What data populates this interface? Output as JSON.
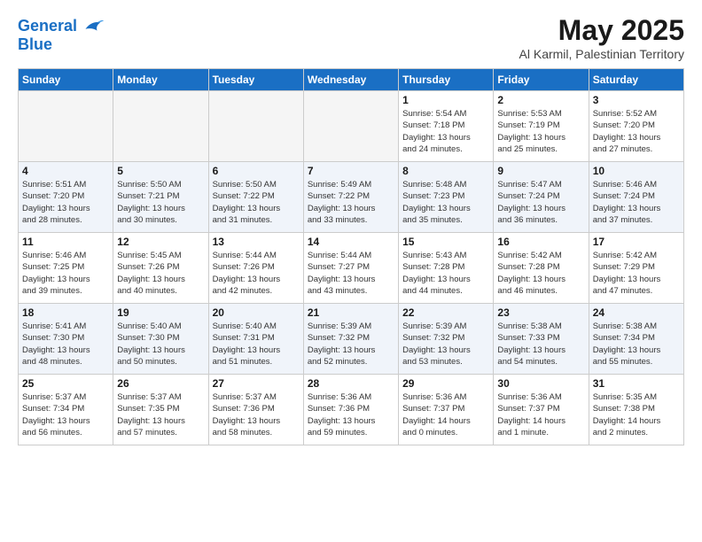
{
  "header": {
    "logo_line1": "General",
    "logo_line2": "Blue",
    "month_title": "May 2025",
    "location": "Al Karmil, Palestinian Territory"
  },
  "days_of_week": [
    "Sunday",
    "Monday",
    "Tuesday",
    "Wednesday",
    "Thursday",
    "Friday",
    "Saturday"
  ],
  "weeks": [
    [
      {
        "day": "",
        "empty": true
      },
      {
        "day": "",
        "empty": true
      },
      {
        "day": "",
        "empty": true
      },
      {
        "day": "",
        "empty": true
      },
      {
        "day": "1",
        "lines": [
          "Sunrise: 5:54 AM",
          "Sunset: 7:18 PM",
          "Daylight: 13 hours",
          "and 24 minutes."
        ]
      },
      {
        "day": "2",
        "lines": [
          "Sunrise: 5:53 AM",
          "Sunset: 7:19 PM",
          "Daylight: 13 hours",
          "and 25 minutes."
        ]
      },
      {
        "day": "3",
        "lines": [
          "Sunrise: 5:52 AM",
          "Sunset: 7:20 PM",
          "Daylight: 13 hours",
          "and 27 minutes."
        ]
      }
    ],
    [
      {
        "day": "4",
        "lines": [
          "Sunrise: 5:51 AM",
          "Sunset: 7:20 PM",
          "Daylight: 13 hours",
          "and 28 minutes."
        ]
      },
      {
        "day": "5",
        "lines": [
          "Sunrise: 5:50 AM",
          "Sunset: 7:21 PM",
          "Daylight: 13 hours",
          "and 30 minutes."
        ]
      },
      {
        "day": "6",
        "lines": [
          "Sunrise: 5:50 AM",
          "Sunset: 7:22 PM",
          "Daylight: 13 hours",
          "and 31 minutes."
        ]
      },
      {
        "day": "7",
        "lines": [
          "Sunrise: 5:49 AM",
          "Sunset: 7:22 PM",
          "Daylight: 13 hours",
          "and 33 minutes."
        ]
      },
      {
        "day": "8",
        "lines": [
          "Sunrise: 5:48 AM",
          "Sunset: 7:23 PM",
          "Daylight: 13 hours",
          "and 35 minutes."
        ]
      },
      {
        "day": "9",
        "lines": [
          "Sunrise: 5:47 AM",
          "Sunset: 7:24 PM",
          "Daylight: 13 hours",
          "and 36 minutes."
        ]
      },
      {
        "day": "10",
        "lines": [
          "Sunrise: 5:46 AM",
          "Sunset: 7:24 PM",
          "Daylight: 13 hours",
          "and 37 minutes."
        ]
      }
    ],
    [
      {
        "day": "11",
        "lines": [
          "Sunrise: 5:46 AM",
          "Sunset: 7:25 PM",
          "Daylight: 13 hours",
          "and 39 minutes."
        ]
      },
      {
        "day": "12",
        "lines": [
          "Sunrise: 5:45 AM",
          "Sunset: 7:26 PM",
          "Daylight: 13 hours",
          "and 40 minutes."
        ]
      },
      {
        "day": "13",
        "lines": [
          "Sunrise: 5:44 AM",
          "Sunset: 7:26 PM",
          "Daylight: 13 hours",
          "and 42 minutes."
        ]
      },
      {
        "day": "14",
        "lines": [
          "Sunrise: 5:44 AM",
          "Sunset: 7:27 PM",
          "Daylight: 13 hours",
          "and 43 minutes."
        ]
      },
      {
        "day": "15",
        "lines": [
          "Sunrise: 5:43 AM",
          "Sunset: 7:28 PM",
          "Daylight: 13 hours",
          "and 44 minutes."
        ]
      },
      {
        "day": "16",
        "lines": [
          "Sunrise: 5:42 AM",
          "Sunset: 7:28 PM",
          "Daylight: 13 hours",
          "and 46 minutes."
        ]
      },
      {
        "day": "17",
        "lines": [
          "Sunrise: 5:42 AM",
          "Sunset: 7:29 PM",
          "Daylight: 13 hours",
          "and 47 minutes."
        ]
      }
    ],
    [
      {
        "day": "18",
        "lines": [
          "Sunrise: 5:41 AM",
          "Sunset: 7:30 PM",
          "Daylight: 13 hours",
          "and 48 minutes."
        ]
      },
      {
        "day": "19",
        "lines": [
          "Sunrise: 5:40 AM",
          "Sunset: 7:30 PM",
          "Daylight: 13 hours",
          "and 50 minutes."
        ]
      },
      {
        "day": "20",
        "lines": [
          "Sunrise: 5:40 AM",
          "Sunset: 7:31 PM",
          "Daylight: 13 hours",
          "and 51 minutes."
        ]
      },
      {
        "day": "21",
        "lines": [
          "Sunrise: 5:39 AM",
          "Sunset: 7:32 PM",
          "Daylight: 13 hours",
          "and 52 minutes."
        ]
      },
      {
        "day": "22",
        "lines": [
          "Sunrise: 5:39 AM",
          "Sunset: 7:32 PM",
          "Daylight: 13 hours",
          "and 53 minutes."
        ]
      },
      {
        "day": "23",
        "lines": [
          "Sunrise: 5:38 AM",
          "Sunset: 7:33 PM",
          "Daylight: 13 hours",
          "and 54 minutes."
        ]
      },
      {
        "day": "24",
        "lines": [
          "Sunrise: 5:38 AM",
          "Sunset: 7:34 PM",
          "Daylight: 13 hours",
          "and 55 minutes."
        ]
      }
    ],
    [
      {
        "day": "25",
        "lines": [
          "Sunrise: 5:37 AM",
          "Sunset: 7:34 PM",
          "Daylight: 13 hours",
          "and 56 minutes."
        ]
      },
      {
        "day": "26",
        "lines": [
          "Sunrise: 5:37 AM",
          "Sunset: 7:35 PM",
          "Daylight: 13 hours",
          "and 57 minutes."
        ]
      },
      {
        "day": "27",
        "lines": [
          "Sunrise: 5:37 AM",
          "Sunset: 7:36 PM",
          "Daylight: 13 hours",
          "and 58 minutes."
        ]
      },
      {
        "day": "28",
        "lines": [
          "Sunrise: 5:36 AM",
          "Sunset: 7:36 PM",
          "Daylight: 13 hours",
          "and 59 minutes."
        ]
      },
      {
        "day": "29",
        "lines": [
          "Sunrise: 5:36 AM",
          "Sunset: 7:37 PM",
          "Daylight: 14 hours",
          "and 0 minutes."
        ]
      },
      {
        "day": "30",
        "lines": [
          "Sunrise: 5:36 AM",
          "Sunset: 7:37 PM",
          "Daylight: 14 hours",
          "and 1 minute."
        ]
      },
      {
        "day": "31",
        "lines": [
          "Sunrise: 5:35 AM",
          "Sunset: 7:38 PM",
          "Daylight: 14 hours",
          "and 2 minutes."
        ]
      }
    ]
  ]
}
